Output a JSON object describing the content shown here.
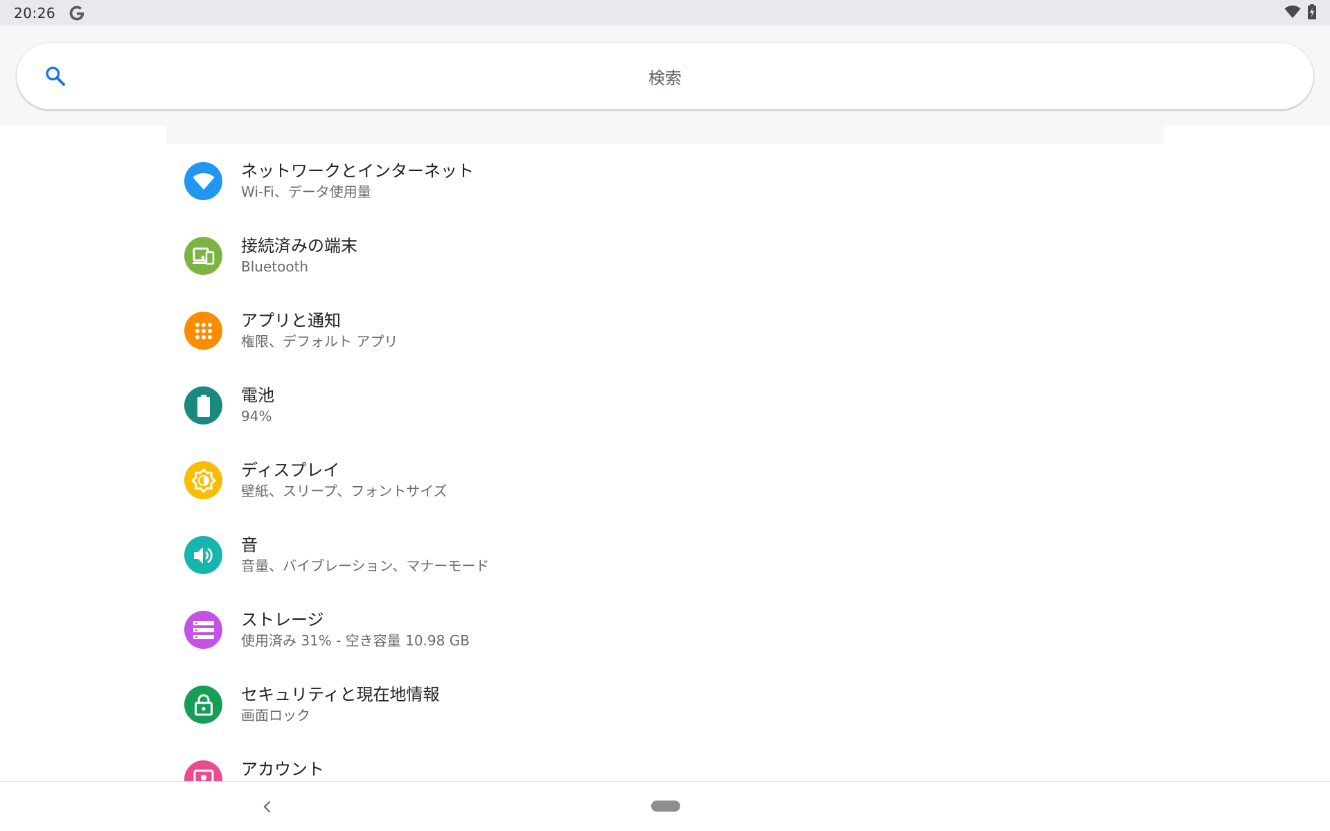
{
  "status_bar": {
    "time": "20:26",
    "icons": [
      "google-g-icon",
      "wifi-icon",
      "battery-charging-icon"
    ]
  },
  "search": {
    "placeholder": "検索"
  },
  "colors": {
    "network": "#2196f3",
    "devices": "#7cb342",
    "apps": "#fb8c00",
    "battery": "#1a8a80",
    "display": "#fbbc04",
    "sound": "#16b5ad",
    "storage": "#c452e4",
    "security": "#169e57",
    "accounts": "#ea4c8f"
  },
  "settings": {
    "items": [
      {
        "title": "ネットワークとインターネット",
        "summary": "Wi-Fi、データ使用量",
        "icon": "wifi-icon"
      },
      {
        "title": "接続済みの端末",
        "summary": "Bluetooth",
        "icon": "devices-icon"
      },
      {
        "title": "アプリと通知",
        "summary": "権限、デフォルト アプリ",
        "icon": "apps-grid-icon"
      },
      {
        "title": "電池",
        "summary": "94%",
        "icon": "battery-icon"
      },
      {
        "title": "ディスプレイ",
        "summary": "壁紙、スリープ、フォントサイズ",
        "icon": "brightness-icon"
      },
      {
        "title": "音",
        "summary": "音量、バイブレーション、マナーモード",
        "icon": "volume-icon"
      },
      {
        "title": "ストレージ",
        "summary": "使用済み 31% - 空き容量 10.98 GB",
        "icon": "storage-icon"
      },
      {
        "title": "セキュリティと現在地情報",
        "summary": "画面ロック",
        "icon": "lock-icon"
      },
      {
        "title": "アカウント",
        "summary": "",
        "icon": "account-icon"
      }
    ]
  },
  "nav_bar": {
    "buttons": [
      "back-icon",
      "home-pill-icon"
    ]
  }
}
